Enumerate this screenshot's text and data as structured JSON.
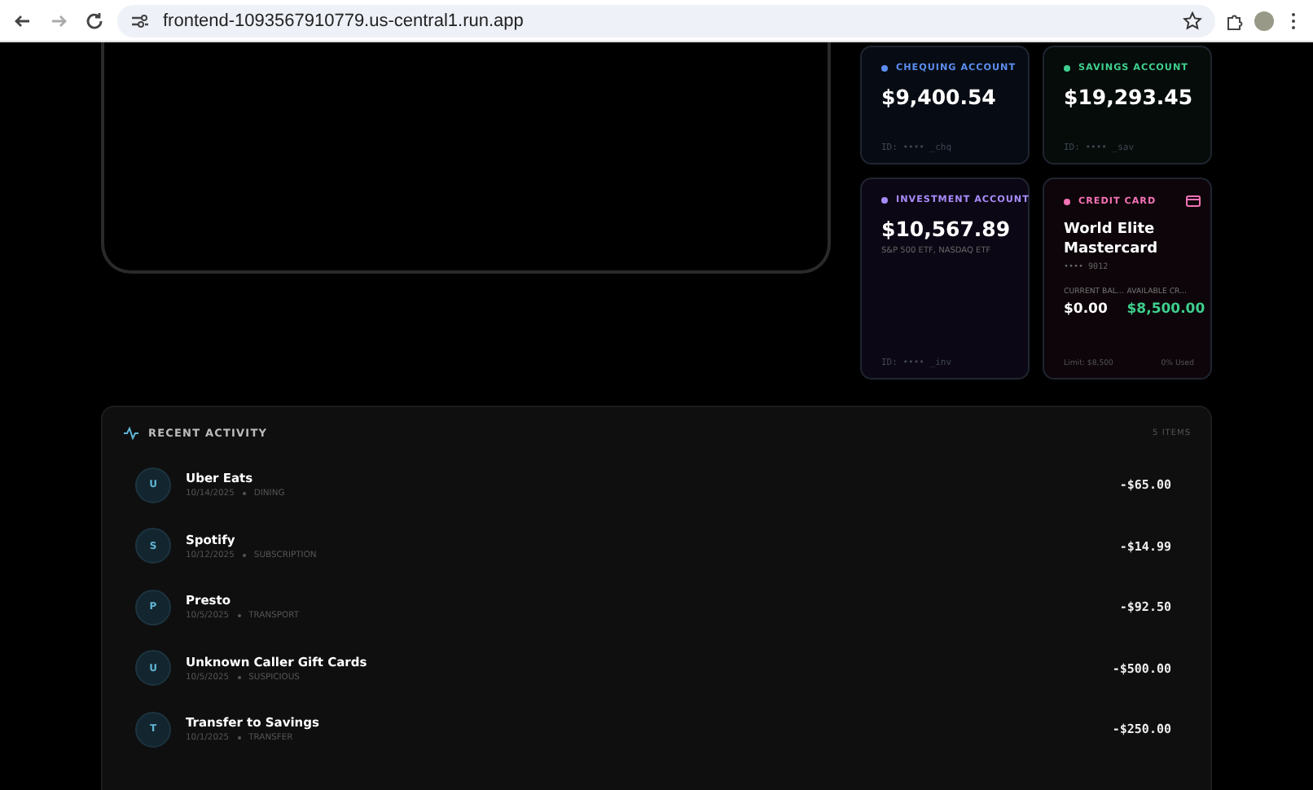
{
  "browser": {
    "url": "frontend-1093567910779.us-central1.run.app"
  },
  "accounts": [
    {
      "kind": "deposit",
      "label": "CHEQUING ACCOUNT",
      "color": "#5b8def",
      "balance": "$9,400.54",
      "id": "ID: •••• _chq"
    },
    {
      "kind": "deposit",
      "label": "SAVINGS ACCOUNT",
      "color": "#3ecf8e",
      "balance": "$19,293.45",
      "id": "ID: •••• _sav"
    },
    {
      "kind": "investment",
      "label": "INVESTMENT ACCOUNT",
      "color": "#a78bfa",
      "balance": "$10,567.89",
      "holdings": "S&P 500 ETF, NASDAQ ETF",
      "id": "ID: •••• _inv"
    },
    {
      "kind": "credit",
      "label": "CREDIT CARD",
      "color": "#f472b6",
      "name": "World Elite Mastercard",
      "number": "•••• 9012",
      "current_label": "CURRENT BAL...",
      "current": "$0.00",
      "available_label": "AVAILABLE CR...",
      "available": "$8,500.00",
      "limit": "Limit: $8,500",
      "used": "0% Used"
    }
  ],
  "activity": {
    "title": "RECENT ACTIVITY",
    "count": "5 ITEMS",
    "items": [
      {
        "initial": "U",
        "name": "Uber Eats",
        "date": "10/14/2025",
        "category": "DINING",
        "amount": "-$65.00"
      },
      {
        "initial": "S",
        "name": "Spotify",
        "date": "10/12/2025",
        "category": "SUBSCRIPTION",
        "amount": "-$14.99"
      },
      {
        "initial": "P",
        "name": "Presto",
        "date": "10/5/2025",
        "category": "TRANSPORT",
        "amount": "-$92.50"
      },
      {
        "initial": "U",
        "name": "Unknown Caller Gift Cards",
        "date": "10/5/2025",
        "category": "SUSPICIOUS",
        "amount": "-$500.00"
      },
      {
        "initial": "T",
        "name": "Transfer to Savings",
        "date": "10/1/2025",
        "category": "TRANSFER",
        "amount": "-$250.00"
      }
    ]
  }
}
